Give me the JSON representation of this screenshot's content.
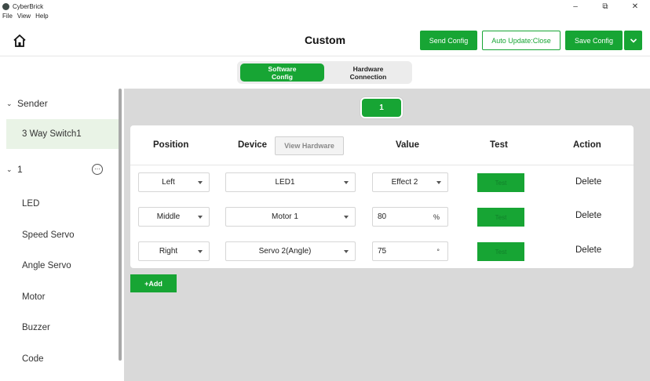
{
  "window": {
    "title": "CyberBrick",
    "minimize": "–",
    "maximize": "⧉",
    "close": "✕"
  },
  "menu": [
    "File",
    "View",
    "Help"
  ],
  "header": {
    "title": "Custom",
    "send_config": "Send Config",
    "auto_update": "Auto Update:Close",
    "save_config": "Save Config"
  },
  "mode_switch": {
    "software": "Software Config",
    "hardware": "Hardware Connection"
  },
  "sidebar": {
    "sender_label": "Sender",
    "sender_item": "3 Way Switch1",
    "group_label": "1",
    "items": [
      "LED",
      "Speed Servo",
      "Angle Servo",
      "Motor",
      "Buzzer",
      "Code"
    ]
  },
  "page_tab": "1",
  "table": {
    "headers": {
      "position": "Position",
      "device": "Device",
      "value": "Value",
      "test": "Test",
      "action": "Action"
    },
    "view_hardware": "View Hardware",
    "rows": [
      {
        "position": "Left",
        "device": "LED1",
        "value": "Effect 2",
        "unit": "",
        "test": "Test",
        "action": "Delete"
      },
      {
        "position": "Middle",
        "device": "Motor 1",
        "value": "80",
        "unit": "%",
        "test": "Test",
        "action": "Delete"
      },
      {
        "position": "Right",
        "device": "Servo 2(Angle)",
        "value": "75",
        "unit": "°",
        "test": "Test",
        "action": "Delete"
      }
    ]
  },
  "add_button": "+Add",
  "colors": {
    "accent": "#17a534",
    "selected_bg": "#e9f3e6",
    "content_bg": "#d9d9d9"
  }
}
